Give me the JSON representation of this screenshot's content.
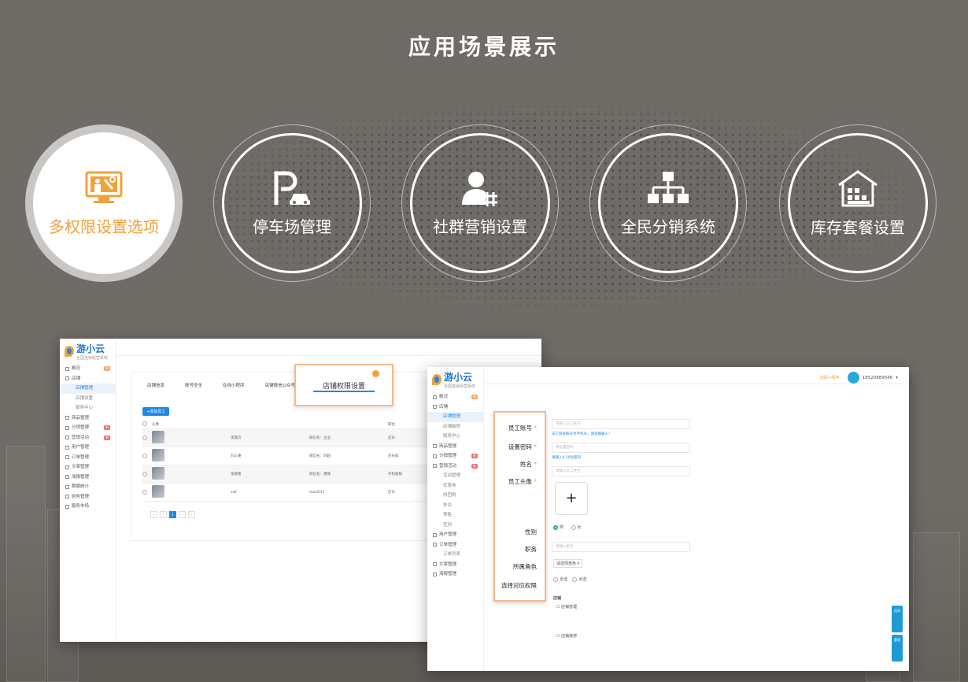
{
  "page": {
    "title": "应用场景展示"
  },
  "features": [
    {
      "label": "多权限设置选项",
      "icon": "monitor-settings-icon",
      "active": true
    },
    {
      "label": "停车场管理",
      "icon": "parking-icon",
      "active": false
    },
    {
      "label": "社群营销设置",
      "icon": "user-hashtag-icon",
      "active": false
    },
    {
      "label": "全民分销系统",
      "icon": "hierarchy-icon",
      "active": false
    },
    {
      "label": "库存套餐设置",
      "icon": "warehouse-icon",
      "active": false
    }
  ],
  "colors": {
    "accent": "#f1a23a",
    "brand_blue": "#1e88e5",
    "background": "#6f6b66"
  },
  "app": {
    "logo": "游小云",
    "logo_sub": "全国连锁经营系统",
    "user_id": "18520889546",
    "qr_link": "扫码小程序"
  },
  "screen1": {
    "sidebar": [
      {
        "label": "概况",
        "badge": "新",
        "sub": false
      },
      {
        "label": "店铺",
        "badge": "",
        "sub": false
      },
      {
        "label": "店铺管理",
        "badge": "",
        "sub": true,
        "selected": true
      },
      {
        "label": "店铺设置",
        "badge": "",
        "sub": true
      },
      {
        "label": "服务中心",
        "badge": "",
        "sub": true
      },
      {
        "label": "商品管理",
        "badge": "",
        "sub": false
      },
      {
        "label": "分销管理",
        "badge": "新",
        "sub": false
      },
      {
        "label": "营销活动",
        "badge": "新",
        "sub": false
      },
      {
        "label": "用户管理",
        "badge": "",
        "sub": false
      },
      {
        "label": "订单管理",
        "badge": "",
        "sub": false
      },
      {
        "label": "文章管理",
        "badge": "",
        "sub": false
      },
      {
        "label": "海报管理",
        "badge": "",
        "sub": false
      },
      {
        "label": "数据统计",
        "badge": "",
        "sub": false
      },
      {
        "label": "财务管理",
        "badge": "",
        "sub": false
      },
      {
        "label": "服务市场",
        "badge": "",
        "sub": false
      }
    ],
    "tabs": [
      "店铺信息",
      "账号安全",
      "在线小程序",
      "店铺微信公众号"
    ],
    "add_button": "+添加员工",
    "table_header": [
      "头像",
      "",
      "",
      "职位"
    ],
    "rows": [
      {
        "name": "李曼云",
        "phone": "微信名：企业",
        "role": "店长"
      },
      {
        "name": "刘三重",
        "phone": "微信名：刘超",
        "role": "店长助"
      },
      {
        "name": "张德隆",
        "phone": "微信名：隆隆",
        "role": "手机收银"
      },
      {
        "name": "zwf",
        "phone": "mw2017",
        "role": "店长"
      }
    ],
    "pager": [
      "«",
      "‹",
      "1",
      "›",
      "»"
    ]
  },
  "callout1": {
    "label": "店铺权限设置"
  },
  "screen2": {
    "sidebar": [
      {
        "label": "概况",
        "badge": "新",
        "sub": false
      },
      {
        "label": "店铺",
        "badge": "",
        "sub": false
      },
      {
        "label": "店铺管理",
        "badge": "",
        "sub": true,
        "selected": true
      },
      {
        "label": "店铺装修",
        "badge": "",
        "sub": true
      },
      {
        "label": "服务中心",
        "badge": "",
        "sub": true
      },
      {
        "label": "商品管理",
        "badge": "",
        "sub": false
      },
      {
        "label": "分销管理",
        "badge": "新",
        "sub": false
      },
      {
        "label": "营销活动",
        "badge": "新",
        "sub": false
      },
      {
        "label": "活动管理",
        "badge": "",
        "sub": true
      },
      {
        "label": "优惠券",
        "badge": "",
        "sub": true
      },
      {
        "label": "拼团购",
        "badge": "",
        "sub": true
      },
      {
        "label": "秒杀",
        "badge": "",
        "sub": true
      },
      {
        "label": "预售",
        "badge": "",
        "sub": true
      },
      {
        "label": "签到",
        "badge": "",
        "sub": true
      },
      {
        "label": "用户管理",
        "badge": "",
        "sub": false
      },
      {
        "label": "订单管理",
        "badge": "",
        "sub": false
      },
      {
        "label": "订单列表",
        "badge": "",
        "sub": true
      },
      {
        "label": "文章管理",
        "badge": "",
        "sub": false
      },
      {
        "label": "海报管理",
        "badge": "",
        "sub": false
      }
    ],
    "fields": [
      {
        "placeholder": "请输入员工账号",
        "hint": "员工登录账号为手机号，请准确输入！"
      },
      {
        "placeholder": "请设置密码",
        "hint": "请输入6-16位密码"
      },
      {
        "placeholder": "请输入员工姓名",
        "hint": ""
      }
    ],
    "gender_options": [
      "男",
      "女"
    ],
    "position_placeholder": "请输入职务",
    "role_select": "请选择角色",
    "sub_options": [
      "全选",
      "全选"
    ],
    "perm_title": "店铺",
    "perm_groups": [
      "店铺管理",
      "店铺装修"
    ],
    "side_buttons": [
      "回顶",
      "客服"
    ]
  },
  "callout2": {
    "labels": [
      "员工账号",
      "设置密码",
      "姓名",
      "员工头像",
      "性别",
      "职务",
      "所属角色",
      "选择对应权限"
    ],
    "required": [
      true,
      true,
      true,
      true,
      false,
      false,
      false,
      false
    ]
  }
}
